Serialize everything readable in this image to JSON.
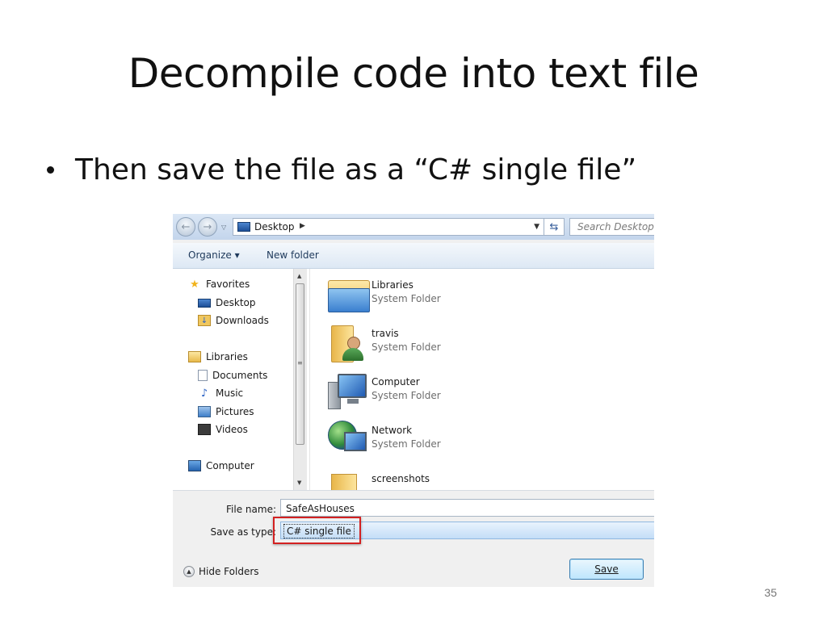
{
  "slide": {
    "title": "Decompile code into text file",
    "bullet": "Then save the file as a “C# single file”",
    "page_number": "35"
  },
  "dialog": {
    "address": "Desktop",
    "search_placeholder": "Search Desktop",
    "toolbar": {
      "organize": "Organize ▾",
      "new_folder": "New folder"
    },
    "nav": {
      "favorites": "Favorites",
      "desktop": "Desktop",
      "downloads": "Downloads",
      "libraries": "Libraries",
      "documents": "Documents",
      "music": "Music",
      "pictures": "Pictures",
      "videos": "Videos",
      "computer": "Computer"
    },
    "files": [
      {
        "name": "Libraries",
        "type": "System Folder"
      },
      {
        "name": "travis",
        "type": "System Folder"
      },
      {
        "name": "Computer",
        "type": "System Folder"
      },
      {
        "name": "Network",
        "type": "System Folder"
      },
      {
        "name": "screenshots",
        "type": ""
      }
    ],
    "file_name_label": "File name:",
    "file_name_value": "SafeAsHouses",
    "save_as_label": "Save as type:",
    "save_as_value": "C# single file",
    "hide_folders": "Hide Folders",
    "save_button": "Save"
  },
  "colors": {
    "highlight_box": "#d32121",
    "accent": "#3c7fb1"
  }
}
